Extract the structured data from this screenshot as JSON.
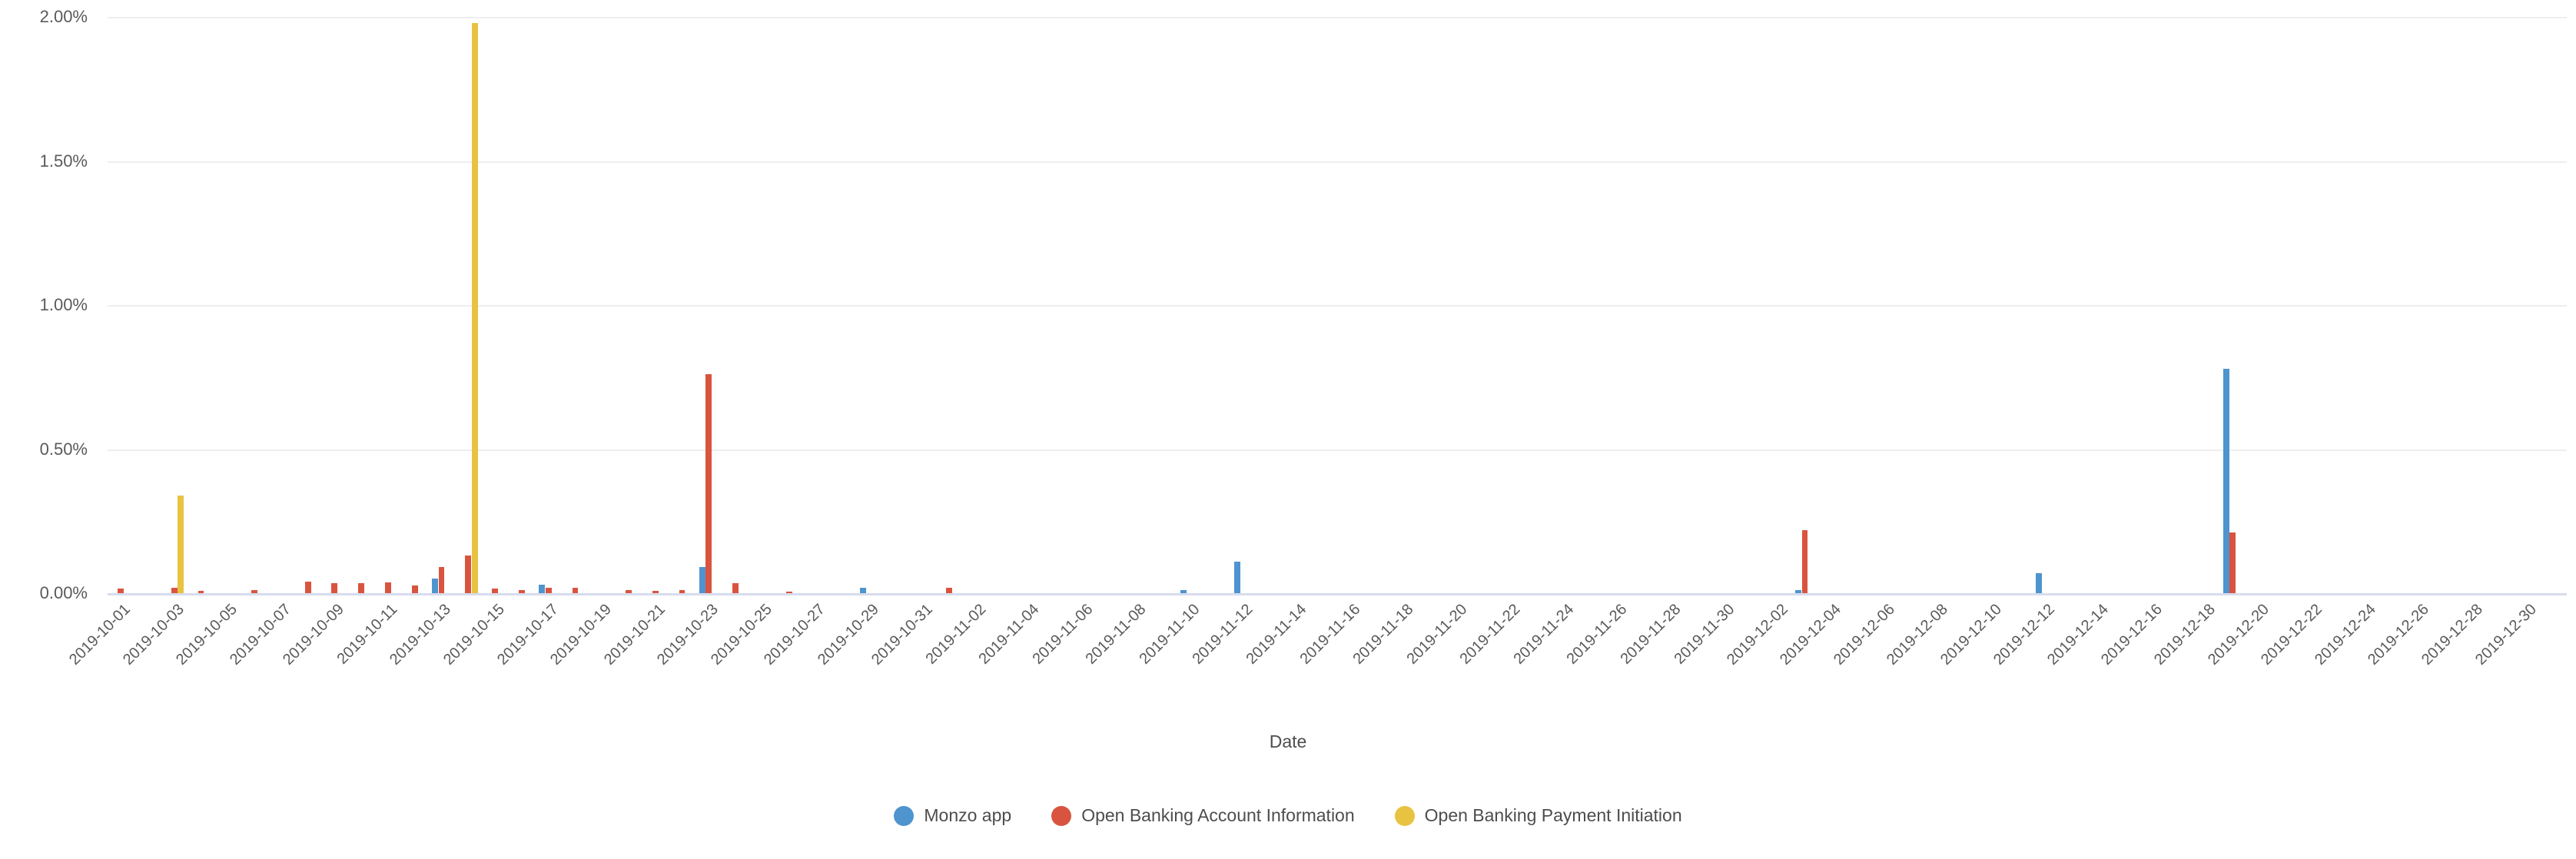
{
  "chart_data": {
    "type": "bar",
    "title": "",
    "subtitle": "",
    "xlabel": "Date",
    "ylabel": "",
    "ylim": [
      0,
      2.0
    ],
    "yticks": [
      0,
      0.5,
      1.0,
      1.5,
      2.0
    ],
    "ytick_labels": [
      "0.00%",
      "0.50%",
      "1.00%",
      "1.50%",
      "2.00%"
    ],
    "grid": true,
    "legend_position": "bottom",
    "bar_mode": "grouped",
    "value_unit": "percent",
    "x": [
      "2019-10-01",
      "2019-10-02",
      "2019-10-03",
      "2019-10-04",
      "2019-10-05",
      "2019-10-06",
      "2019-10-07",
      "2019-10-08",
      "2019-10-09",
      "2019-10-10",
      "2019-10-11",
      "2019-10-12",
      "2019-10-13",
      "2019-10-14",
      "2019-10-15",
      "2019-10-16",
      "2019-10-17",
      "2019-10-18",
      "2019-10-19",
      "2019-10-20",
      "2019-10-21",
      "2019-10-22",
      "2019-10-23",
      "2019-10-24",
      "2019-10-25",
      "2019-10-26",
      "2019-10-27",
      "2019-10-28",
      "2019-10-29",
      "2019-10-30",
      "2019-10-31",
      "2019-11-01",
      "2019-11-02",
      "2019-11-03",
      "2019-11-04",
      "2019-11-05",
      "2019-11-06",
      "2019-11-07",
      "2019-11-08",
      "2019-11-09",
      "2019-11-10",
      "2019-11-11",
      "2019-11-12",
      "2019-11-13",
      "2019-11-14",
      "2019-11-15",
      "2019-11-16",
      "2019-11-17",
      "2019-11-18",
      "2019-11-19",
      "2019-11-20",
      "2019-11-21",
      "2019-11-22",
      "2019-11-23",
      "2019-11-24",
      "2019-11-25",
      "2019-11-26",
      "2019-11-27",
      "2019-11-28",
      "2019-11-29",
      "2019-11-30",
      "2019-12-01",
      "2019-12-02",
      "2019-12-03",
      "2019-12-04",
      "2019-12-05",
      "2019-12-06",
      "2019-12-07",
      "2019-12-08",
      "2019-12-09",
      "2019-12-10",
      "2019-12-11",
      "2019-12-12",
      "2019-12-13",
      "2019-12-14",
      "2019-12-15",
      "2019-12-16",
      "2019-12-17",
      "2019-12-18",
      "2019-12-19",
      "2019-12-20",
      "2019-12-21",
      "2019-12-22",
      "2019-12-23",
      "2019-12-24",
      "2019-12-25",
      "2019-12-26",
      "2019-12-27",
      "2019-12-28",
      "2019-12-29",
      "2019-12-30",
      "2019-12-31"
    ],
    "xtick_labels": [
      "2019-10-01",
      "2019-10-03",
      "2019-10-05",
      "2019-10-07",
      "2019-10-09",
      "2019-10-11",
      "2019-10-13",
      "2019-10-15",
      "2019-10-17",
      "2019-10-19",
      "2019-10-21",
      "2019-10-23",
      "2019-10-25",
      "2019-10-27",
      "2019-10-29",
      "2019-10-31",
      "2019-11-02",
      "2019-11-04",
      "2019-11-06",
      "2019-11-08",
      "2019-11-10",
      "2019-11-12",
      "2019-11-14",
      "2019-11-16",
      "2019-11-18",
      "2019-11-20",
      "2019-11-22",
      "2019-11-24",
      "2019-11-26",
      "2019-11-28",
      "2019-11-30",
      "2019-12-02",
      "2019-12-04",
      "2019-12-06",
      "2019-12-08",
      "2019-12-10",
      "2019-12-12",
      "2019-12-14",
      "2019-12-16",
      "2019-12-18",
      "2019-12-20",
      "2019-12-22",
      "2019-12-24",
      "2019-12-26",
      "2019-12-28",
      "2019-12-30"
    ],
    "series": [
      {
        "name": "Monzo app",
        "color": "#4e94ce",
        "values": [
          0,
          0,
          0,
          0,
          0,
          0,
          0,
          0,
          0,
          0,
          0,
          0,
          0.05,
          0,
          0,
          0,
          0.03,
          0,
          0,
          0,
          0,
          0,
          0.09,
          0,
          0,
          0,
          0,
          0,
          0.02,
          0,
          0,
          0,
          0,
          0,
          0,
          0,
          0,
          0,
          0,
          0,
          0.01,
          0,
          0.11,
          0,
          0,
          0,
          0,
          0,
          0,
          0,
          0,
          0,
          0,
          0,
          0,
          0,
          0,
          0,
          0,
          0,
          0,
          0,
          0,
          0.01,
          0,
          0,
          0,
          0,
          0,
          0,
          0,
          0,
          0.07,
          0,
          0,
          0,
          0,
          0,
          0,
          0.78,
          0,
          0,
          0,
          0,
          0,
          0,
          0,
          0,
          0,
          0,
          0,
          0
        ]
      },
      {
        "name": "Open Banking Account Information",
        "color": "#d9543f",
        "values": [
          0.015,
          0,
          0.018,
          0.008,
          0,
          0.012,
          0,
          0.04,
          0.035,
          0.034,
          0.037,
          0.028,
          0.09,
          0.13,
          0.016,
          0.012,
          0.018,
          0.02,
          0,
          0.01,
          0.007,
          0.012,
          0.76,
          0.035,
          0,
          0.005,
          0,
          0,
          0,
          0,
          0,
          0.018,
          0,
          0,
          0,
          0,
          0,
          0,
          0,
          0,
          0,
          0,
          0,
          0,
          0,
          0,
          0,
          0,
          0,
          0,
          0,
          0,
          0,
          0,
          0,
          0,
          0,
          0,
          0,
          0,
          0,
          0,
          0,
          0.22,
          0,
          0,
          0,
          0,
          0,
          0,
          0,
          0,
          0,
          0,
          0,
          0,
          0,
          0,
          0,
          0.21,
          0,
          0,
          0,
          0,
          0,
          0,
          0,
          0,
          0,
          0,
          0,
          0
        ]
      },
      {
        "name": "Open Banking Payment Initiation",
        "color": "#e8c341",
        "values": [
          0,
          0,
          0.34,
          0,
          0,
          0,
          0,
          0,
          0,
          0,
          0,
          0,
          0,
          1.98,
          0,
          0,
          0,
          0,
          0,
          0,
          0,
          0,
          0,
          0,
          0,
          0,
          0,
          0,
          0,
          0,
          0,
          0,
          0,
          0,
          0,
          0,
          0,
          0,
          0,
          0,
          0,
          0,
          0,
          0,
          0,
          0,
          0,
          0,
          0,
          0,
          0,
          0,
          0,
          0,
          0,
          0,
          0,
          0,
          0,
          0,
          0,
          0,
          0,
          0,
          0,
          0,
          0,
          0,
          0,
          0,
          0,
          0,
          0,
          0,
          0,
          0,
          0,
          0,
          0,
          0,
          0,
          0,
          0,
          0,
          0,
          0,
          0,
          0,
          0,
          0,
          0,
          0
        ]
      }
    ]
  },
  "axis": {
    "x_title": "Date"
  },
  "legend": {
    "items": [
      {
        "label": "Monzo app",
        "color": "#4e94ce"
      },
      {
        "label": "Open Banking Account Information",
        "color": "#d9543f"
      },
      {
        "label": "Open Banking Payment Initiation",
        "color": "#e8c341"
      }
    ]
  }
}
